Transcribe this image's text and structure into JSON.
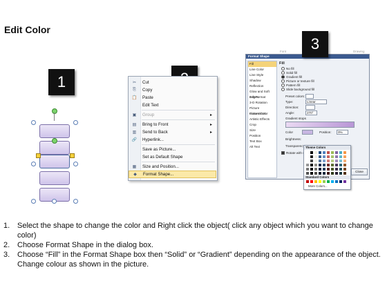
{
  "page": {
    "title": "Edit Color"
  },
  "badges": [
    "1",
    "2",
    "3"
  ],
  "context_menu": {
    "items": [
      {
        "icon": "✂",
        "label": "Cut",
        "disabled": false,
        "submenu": false
      },
      {
        "icon": "⎘",
        "label": "Copy",
        "disabled": false,
        "submenu": false
      },
      {
        "icon": "📋",
        "label": "Paste",
        "disabled": false,
        "submenu": false
      },
      {
        "icon": "",
        "label": "Edit Text",
        "disabled": false,
        "submenu": false
      },
      {
        "icon": "▣",
        "label": "Group",
        "disabled": true,
        "submenu": true
      },
      {
        "icon": "▤",
        "label": "Bring to Front",
        "disabled": false,
        "submenu": true
      },
      {
        "icon": "▥",
        "label": "Send to Back",
        "disabled": false,
        "submenu": true
      },
      {
        "icon": "🔗",
        "label": "Hyperlink...",
        "disabled": false,
        "submenu": false
      },
      {
        "icon": "",
        "label": "Save as Picture...",
        "disabled": false,
        "submenu": false
      },
      {
        "icon": "",
        "label": "Set as Default Shape",
        "disabled": false,
        "submenu": false
      },
      {
        "icon": "▦",
        "label": "Size and Position...",
        "disabled": false,
        "submenu": false
      },
      {
        "icon": "◆",
        "label": "Format Shape...",
        "disabled": false,
        "submenu": false,
        "highlighted": true
      }
    ]
  },
  "format_dialog": {
    "title": "Format Shape",
    "background_labels": [
      "Font",
      "Drawing"
    ],
    "sidebar": [
      "Fill",
      "Line Color",
      "Line Style",
      "Shadow",
      "Reflection",
      "Glow and Soft Edges",
      "3-D Format",
      "3-D Rotation",
      "Picture Corrections",
      "Picture Color",
      "Artistic Effects",
      "Crop",
      "Size",
      "Position",
      "Text Box",
      "Alt Text"
    ],
    "selected_sidebar": "Fill",
    "pane_heading": "Fill",
    "fill_options": [
      "No fill",
      "Solid fill",
      "Gradient fill",
      "Picture or texture fill",
      "Pattern fill",
      "Slide background fill"
    ],
    "selected_fill": "Gradient fill",
    "labels": {
      "preset": "Preset colors:",
      "type": "Type:",
      "type_value": "Linear",
      "direction": "Direction:",
      "angle": "Angle:",
      "angle_value": "270°",
      "gradient_stops": "Gradient stops",
      "color": "Color",
      "position": "Position:",
      "position_value": "0%",
      "brightness": "Brightness:",
      "transparency": "Transparency:",
      "rotate": "Rotate with shape"
    },
    "palette": {
      "theme_heading": "Theme Colors",
      "standard_heading": "Standard Colors",
      "more": "More Colors...",
      "theme_top": [
        "#ffffff",
        "#000000",
        "#eeece1",
        "#1f497d",
        "#4f81bd",
        "#c0504d",
        "#9bbb59",
        "#8064a2",
        "#4bacc6",
        "#f79646"
      ],
      "standard": [
        "#c00000",
        "#ff0000",
        "#ffc000",
        "#ffff00",
        "#92d050",
        "#00b050",
        "#00b0f0",
        "#0070c0",
        "#002060",
        "#7030a0"
      ]
    },
    "close_label": "Close"
  },
  "steps": [
    {
      "num": "1.",
      "text": "Select the shape to change the color and Right click the object( click any object which you want to change color)"
    },
    {
      "num": "2.",
      "text": "Choose Format Shape in the dialog box."
    },
    {
      "num": "3.",
      "text": "Choose “Fill” in the Format Shape box then “Solid” or “Gradient” depending on the appearance of the object. Change colour as shown in the picture."
    }
  ],
  "colors": {
    "accent_highlight": "#fbe9a8",
    "shape_fill": "#d9d0ef",
    "badge": "#111111",
    "dialog_title": "#3b5a8f"
  }
}
